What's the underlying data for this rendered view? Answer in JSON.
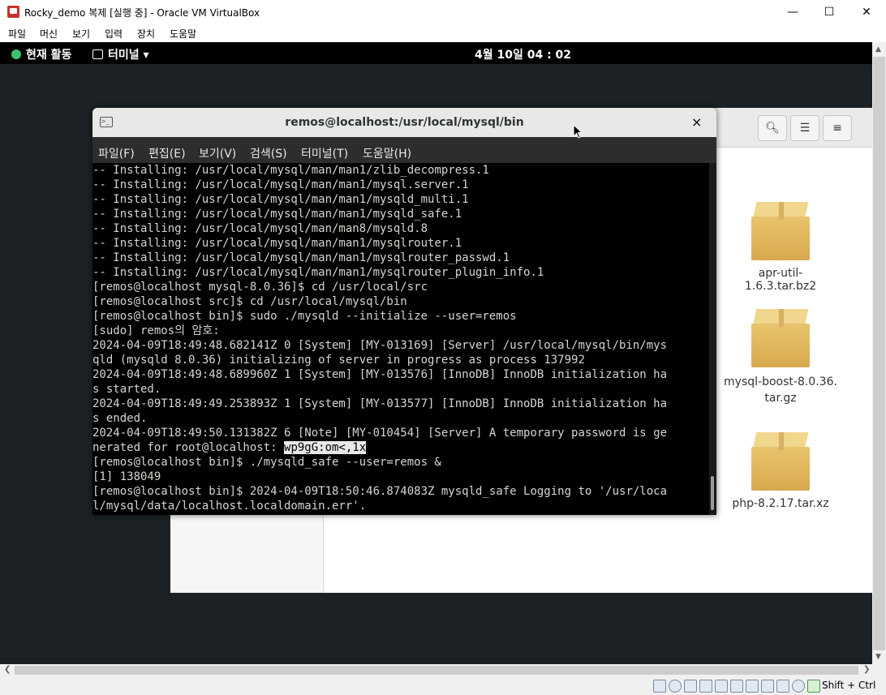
{
  "window": {
    "title": "Rocky_demo 복제 [실행 중] - Oracle VM VirtualBox",
    "minimize": "—",
    "maximize": "☐",
    "close": "✕"
  },
  "vb_menu": [
    "파일",
    "머신",
    "보기",
    "입력",
    "장치",
    "도움말"
  ],
  "gnome": {
    "activities": "현재 활동",
    "app_menu": "터미널 ▾",
    "clock": "4월 10일  04 : 02"
  },
  "files": {
    "items": [
      {
        "name": "apr-util-1.6.3.tar.bz2"
      },
      {
        "name": "mysql-boost-8.0.36.\ntar.gz"
      },
      {
        "name": "php-8.2.17.tar.xz"
      }
    ]
  },
  "terminal": {
    "title": "remos@localhost:/usr/local/mysql/bin",
    "close": "×",
    "menu": [
      "파일(F)",
      "편집(E)",
      "보기(V)",
      "검색(S)",
      "터미널(T)",
      "도움말(H)"
    ],
    "lines": [
      "-- Installing: /usr/local/mysql/man/man1/zlib_decompress.1",
      "-- Installing: /usr/local/mysql/man/man1/mysql.server.1",
      "-- Installing: /usr/local/mysql/man/man1/mysqld_multi.1",
      "-- Installing: /usr/local/mysql/man/man1/mysqld_safe.1",
      "-- Installing: /usr/local/mysql/man/man8/mysqld.8",
      "-- Installing: /usr/local/mysql/man/man1/mysqlrouter.1",
      "-- Installing: /usr/local/mysql/man/man1/mysqlrouter_passwd.1",
      "-- Installing: /usr/local/mysql/man/man1/mysqlrouter_plugin_info.1",
      "[remos@localhost mysql-8.0.36]$ cd /usr/local/src",
      "[remos@localhost src]$ cd /usr/local/mysql/bin",
      "[remos@localhost bin]$ sudo ./mysqld --initialize --user=remos",
      "[sudo] remos의 암호:",
      "2024-04-09T18:49:48.682141Z 0 [System] [MY-013169] [Server] /usr/local/mysql/bin/mys",
      "qld (mysqld 8.0.36) initializing of server in progress as process 137992",
      "2024-04-09T18:49:48.689960Z 1 [System] [MY-013576] [InnoDB] InnoDB initialization ha",
      "s started.",
      "2024-04-09T18:49:49.253893Z 1 [System] [MY-013577] [InnoDB] InnoDB initialization ha",
      "s ended.",
      "2024-04-09T18:49:50.131382Z 6 [Note] [MY-010454] [Server] A temporary password is ge",
      "nerated for root@localhost: ",
      "[remos@localhost bin]$ ./mysqld_safe --user=remos &",
      "[1] 138049",
      "[remos@localhost bin]$ 2024-04-09T18:50:46.874083Z mysqld_safe Logging to '/usr/loca",
      "l/mysql/data/localhost.localdomain.err'."
    ],
    "password_highlight": "wp9gG:om<,1x"
  },
  "status": {
    "hostkey": "Shift + Ctrl"
  }
}
